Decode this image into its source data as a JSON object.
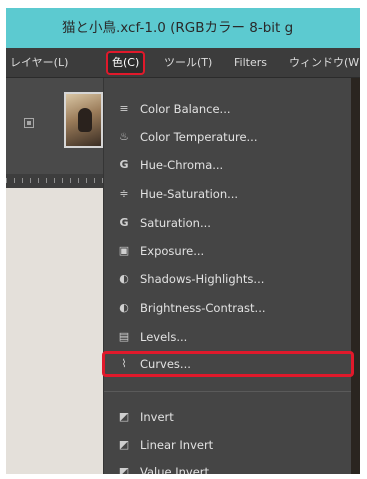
{
  "window": {
    "title": "猫と小鳥.xcf-1.0 (RGBカラー 8-bit g"
  },
  "menubar": {
    "items": [
      {
        "label": "レイヤー(L)",
        "active": false
      },
      {
        "label": "色(C)",
        "active": true
      },
      {
        "label": "ツール(T)",
        "active": false
      },
      {
        "label": "Filters",
        "active": false
      },
      {
        "label": "ウィンドウ(W",
        "active": false
      }
    ]
  },
  "color_menu": {
    "items": [
      {
        "label": "Color Balance...",
        "icon": "color-balance-icon",
        "glyph": "≡"
      },
      {
        "label": "Color Temperature...",
        "icon": "thermometer-icon",
        "glyph": "♨"
      },
      {
        "label": "Hue-Chroma...",
        "icon": "hue-chroma-icon",
        "glyph": "G"
      },
      {
        "label": "Hue-Saturation...",
        "icon": "hue-saturation-icon",
        "glyph": "≑"
      },
      {
        "label": "Saturation...",
        "icon": "saturation-icon",
        "glyph": "G"
      },
      {
        "label": "Exposure...",
        "icon": "exposure-icon",
        "glyph": "▣"
      },
      {
        "label": "Shadows-Highlights...",
        "icon": "shadows-highlights-icon",
        "glyph": "◐"
      },
      {
        "label": "Brightness-Contrast...",
        "icon": "brightness-contrast-icon",
        "glyph": "◐"
      },
      {
        "label": "Levels...",
        "icon": "levels-icon",
        "glyph": "▤"
      },
      {
        "label": "Curves...",
        "icon": "curves-icon",
        "glyph": "⌇"
      },
      {
        "label": "Invert",
        "icon": "invert-icon",
        "glyph": "◩"
      },
      {
        "label": "Linear Invert",
        "icon": "linear-invert-icon",
        "glyph": "◩"
      },
      {
        "label": "Value Invert",
        "icon": "value-invert-icon",
        "glyph": "◩"
      }
    ],
    "highlighted": "Curves..."
  },
  "colors": {
    "titlebar": "#5ccad0",
    "menu_bg": "#454545",
    "highlight_outline": "#e0192b",
    "text": "#e2e2e2"
  }
}
